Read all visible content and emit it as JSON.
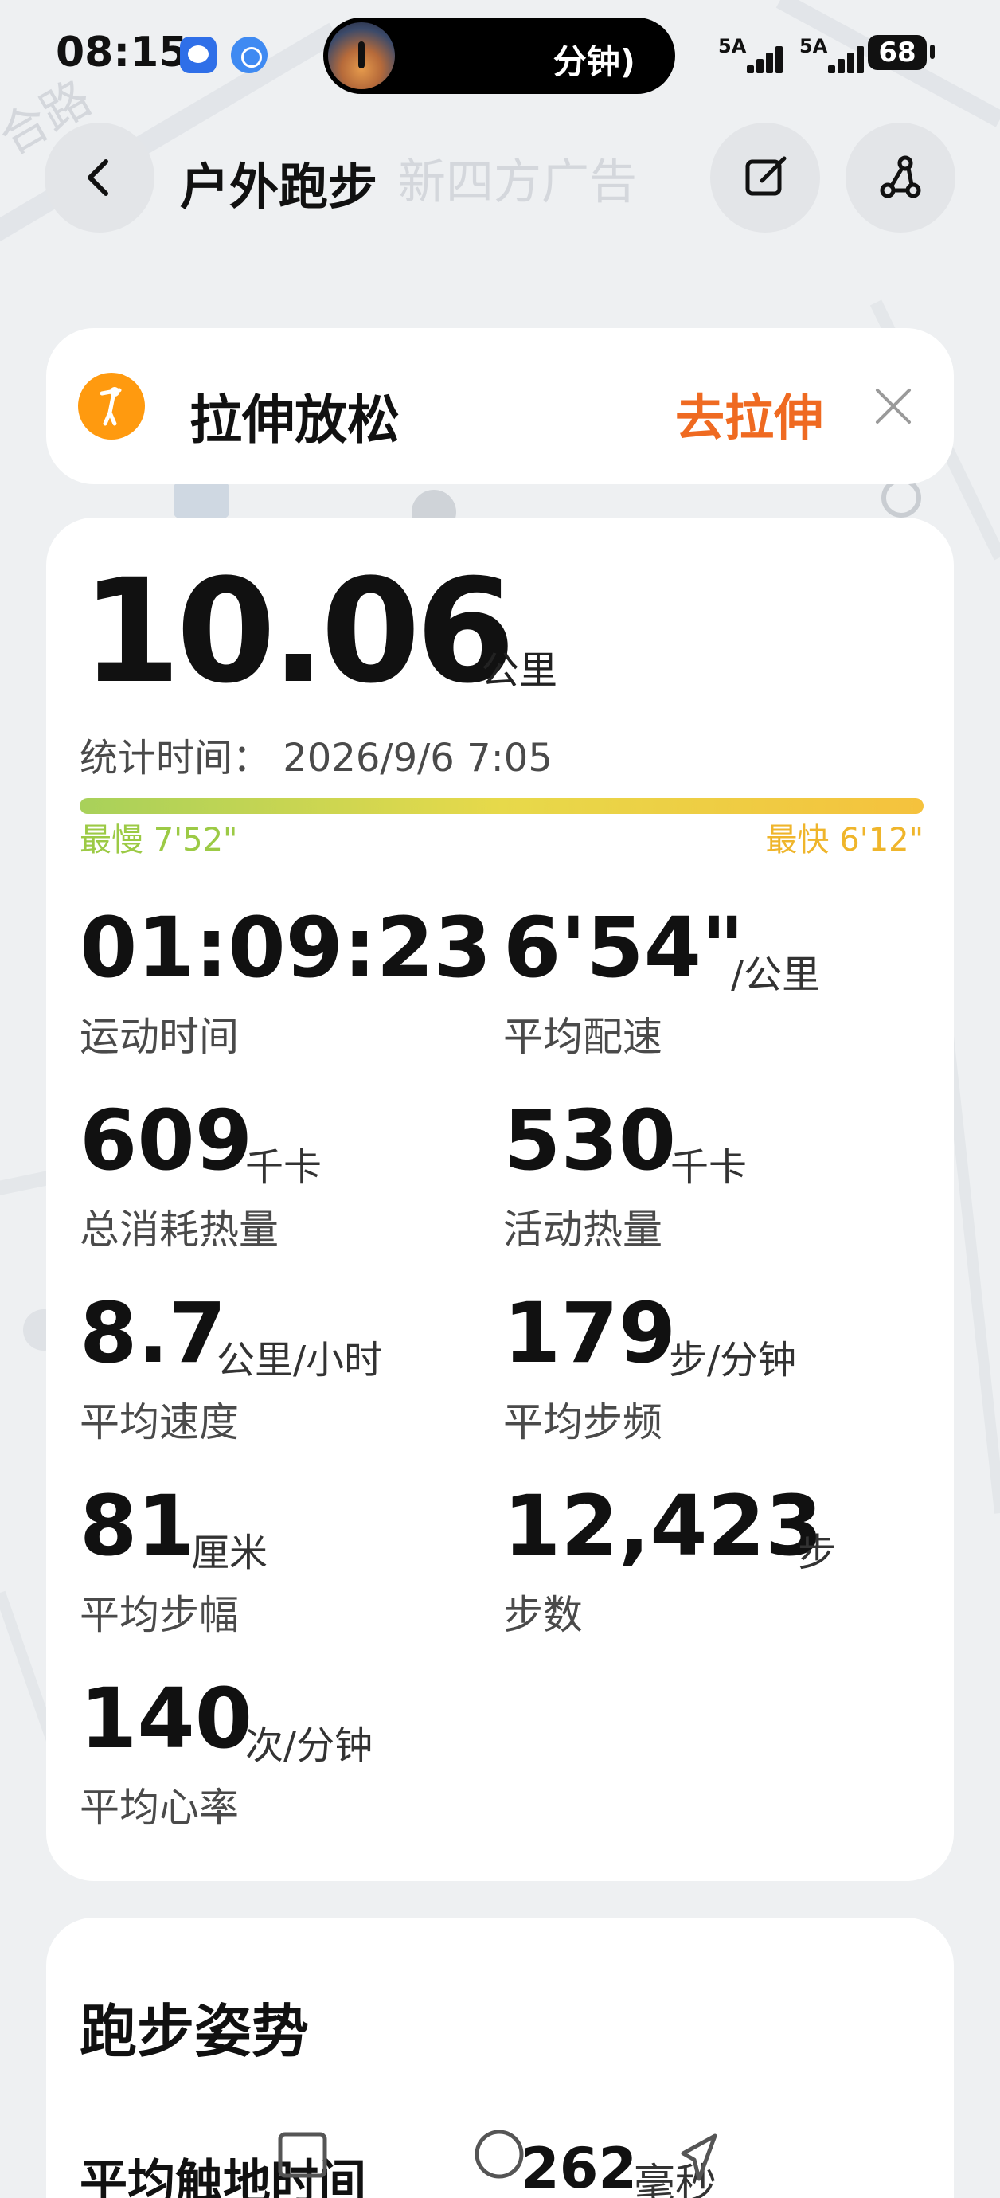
{
  "status_bar": {
    "time": "08:15",
    "island_text": "分钟)",
    "signal_1": "5A",
    "signal_2": "5A",
    "battery": "68"
  },
  "header": {
    "title": "户外跑步"
  },
  "map": {
    "labels": [
      "新四方广告",
      "合路"
    ]
  },
  "stretch_banner": {
    "title": "拉伸放松",
    "action": "去拉伸"
  },
  "summary": {
    "distance": "10.06",
    "distance_unit": "公里",
    "record_time": "统计时间：  2026/9/6 7:05",
    "pace_slowest": "最慢 7'52\"",
    "pace_fastest": "最快 6'12\""
  },
  "metrics": [
    {
      "value": "01:09:23",
      "unit": "",
      "label": "运动时间"
    },
    {
      "value": "6'54\"",
      "unit": "/公里",
      "label": "平均配速"
    },
    {
      "value": "609",
      "unit": "千卡",
      "label": "总消耗热量"
    },
    {
      "value": "530",
      "unit": "千卡",
      "label": "活动热量"
    },
    {
      "value": "8.7",
      "unit": "公里/小时",
      "label": "平均速度"
    },
    {
      "value": "179",
      "unit": "步/分钟",
      "label": "平均步频"
    },
    {
      "value": "81",
      "unit": "厘米",
      "label": "平均步幅"
    },
    {
      "value": "12,423",
      "unit": "步",
      "label": "步数"
    },
    {
      "value": "140",
      "unit": "次/分钟",
      "label": "平均心率"
    }
  ],
  "posture": {
    "title": "跑步姿势",
    "contact_label": "平均触地时间",
    "contact_value": "262",
    "contact_unit": "毫秒"
  },
  "colors": {
    "accent": "#ef6a21",
    "stretch_icon": "#ff9a0f",
    "pace_slow": "#9cca45",
    "pace_fast": "#efb52b"
  }
}
